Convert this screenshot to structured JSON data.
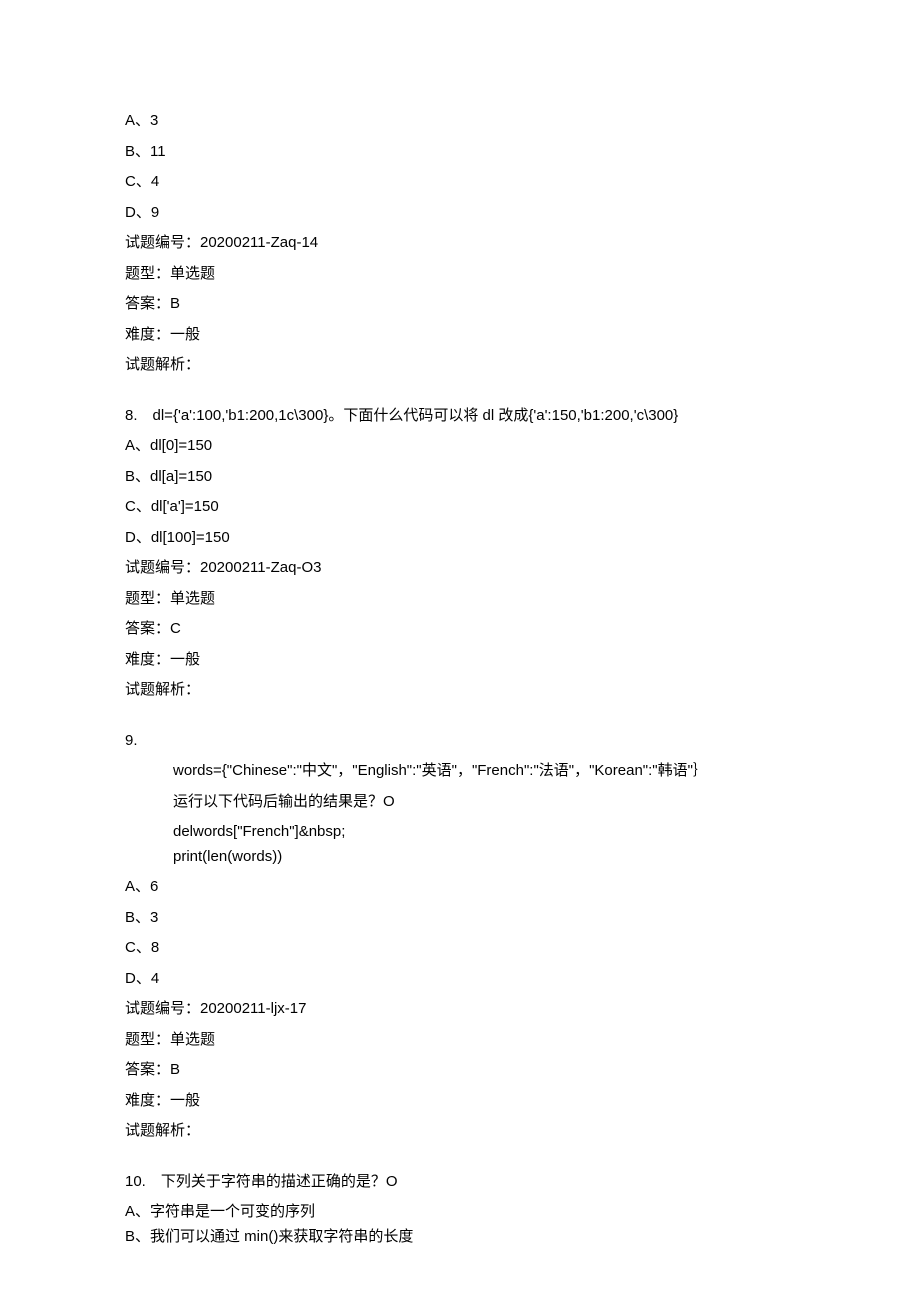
{
  "q7": {
    "optA": "A、3",
    "optB": "B、11",
    "optC": "C、4",
    "optD": "D、9",
    "idLabel": "试题编号：20200211-Zaq-14",
    "typeLabel": "题型：单选题",
    "answerLabel": "答案：B",
    "diffLabel": "难度：一般",
    "analysisLabel": "试题解析："
  },
  "q8": {
    "stem": "8.　dl={'a':100,'b1:200,1c\\300}。下面什么代码可以将 dl 改成{'a':150,'b1:200,'c\\300}",
    "optA": "A、dl[0]=150",
    "optB": "B、dl[a]=150",
    "optC": "C、dl['a']=150",
    "optD": "D、dl[100]=150",
    "idLabel": "试题编号：20200211-Zaq-O3",
    "typeLabel": "题型：单选题",
    "answerLabel": "答案：C",
    "diffLabel": "难度：一般",
    "analysisLabel": "试题解析："
  },
  "q9": {
    "num": "9.",
    "code1": "words={\"Chinese\":\"中文\"，\"English\":\"英语\"，\"French\":\"法语\"，\"Korean\":\"韩语\"｝",
    "code2": "运行以下代码后输出的结果是？O",
    "code3": "delwords[\"French\"]&nbsp;",
    "code4": "print(len(words))",
    "optA": "A、6",
    "optB": "B、3",
    "optC": "C、8",
    "optD": "D、4",
    "idLabel": "试题编号：20200211-ljx-17",
    "typeLabel": "题型：单选题",
    "answerLabel": "答案：B",
    "diffLabel": "难度：一般",
    "analysisLabel": "试题解析："
  },
  "q10": {
    "stem": "10.　下列关于字符串的描述正确的是？O",
    "optA": "A、字符串是一个可变的序列",
    "optB": "B、我们可以通过 min()来获取字符串的长度"
  }
}
